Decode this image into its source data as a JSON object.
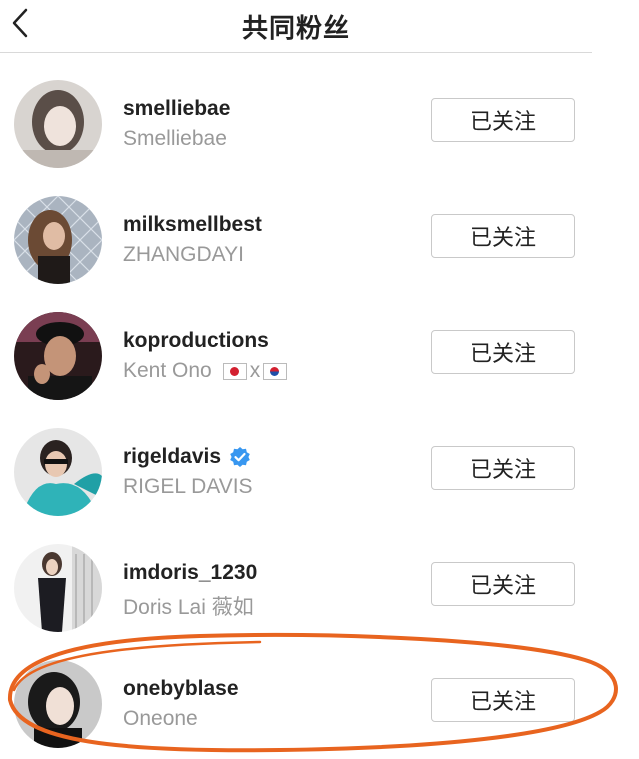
{
  "header": {
    "title": "共同粉丝",
    "back_icon": "chevron-left-icon"
  },
  "followers": [
    {
      "username": "smelliebae",
      "full_name": "Smelliebae",
      "button_label": "已关注",
      "verified": false
    },
    {
      "username": "milksmellbest",
      "full_name": "ZHANGDAYI",
      "button_label": "已关注",
      "verified": false
    },
    {
      "username": "koproductions",
      "full_name": "Kent Ono",
      "flags": [
        "japan-flag-icon",
        "x",
        "south-korea-flag-icon"
      ],
      "flag_separator": "x",
      "button_label": "已关注",
      "verified": false
    },
    {
      "username": "rigeldavis",
      "full_name": "RIGEL DAVIS",
      "button_label": "已关注",
      "verified": true
    },
    {
      "username": "imdoris_1230",
      "full_name": "Doris Lai 薇如",
      "button_label": "已关注",
      "verified": false
    },
    {
      "username": "onebyblase",
      "full_name": "Oneone",
      "button_label": "已关注",
      "verified": false,
      "highlighted": true
    }
  ],
  "colors": {
    "highlight_circle": "#e8641f",
    "verified_badge": "#3897f0",
    "secondary_text": "#999999",
    "primary_text": "#222222"
  }
}
